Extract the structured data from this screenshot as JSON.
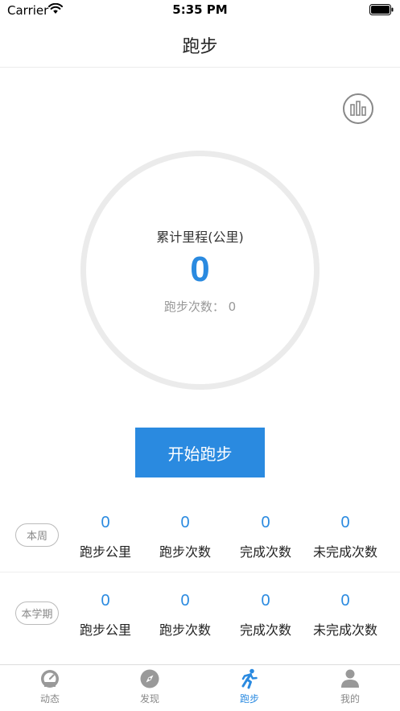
{
  "status_bar": {
    "carrier": "Carrier",
    "time": "5:35 PM"
  },
  "nav": {
    "title": "跑步"
  },
  "summary": {
    "label": "累计里程(公里)",
    "distance": "0",
    "runs_label": "跑步次数：",
    "runs_value": "0",
    "runs_text": "跑步次数： 0"
  },
  "start_button": {
    "label": "开始跑步"
  },
  "stats": {
    "labels": [
      "跑步公里",
      "跑步次数",
      "完成次数",
      "未完成次数"
    ],
    "week": {
      "badge": "本周",
      "values": [
        "0",
        "0",
        "0",
        "0"
      ]
    },
    "term": {
      "badge": "本学期",
      "values": [
        "0",
        "0",
        "0",
        "0"
      ]
    }
  },
  "tabs": [
    {
      "label": "动态",
      "icon": "speedometer-icon",
      "active": false
    },
    {
      "label": "发现",
      "icon": "compass-icon",
      "active": false
    },
    {
      "label": "跑步",
      "icon": "runner-icon",
      "active": true
    },
    {
      "label": "我的",
      "icon": "person-icon",
      "active": false
    }
  ],
  "colors": {
    "accent": "#2a8ae0",
    "inactive": "#888888",
    "ring": "#ebebeb"
  }
}
